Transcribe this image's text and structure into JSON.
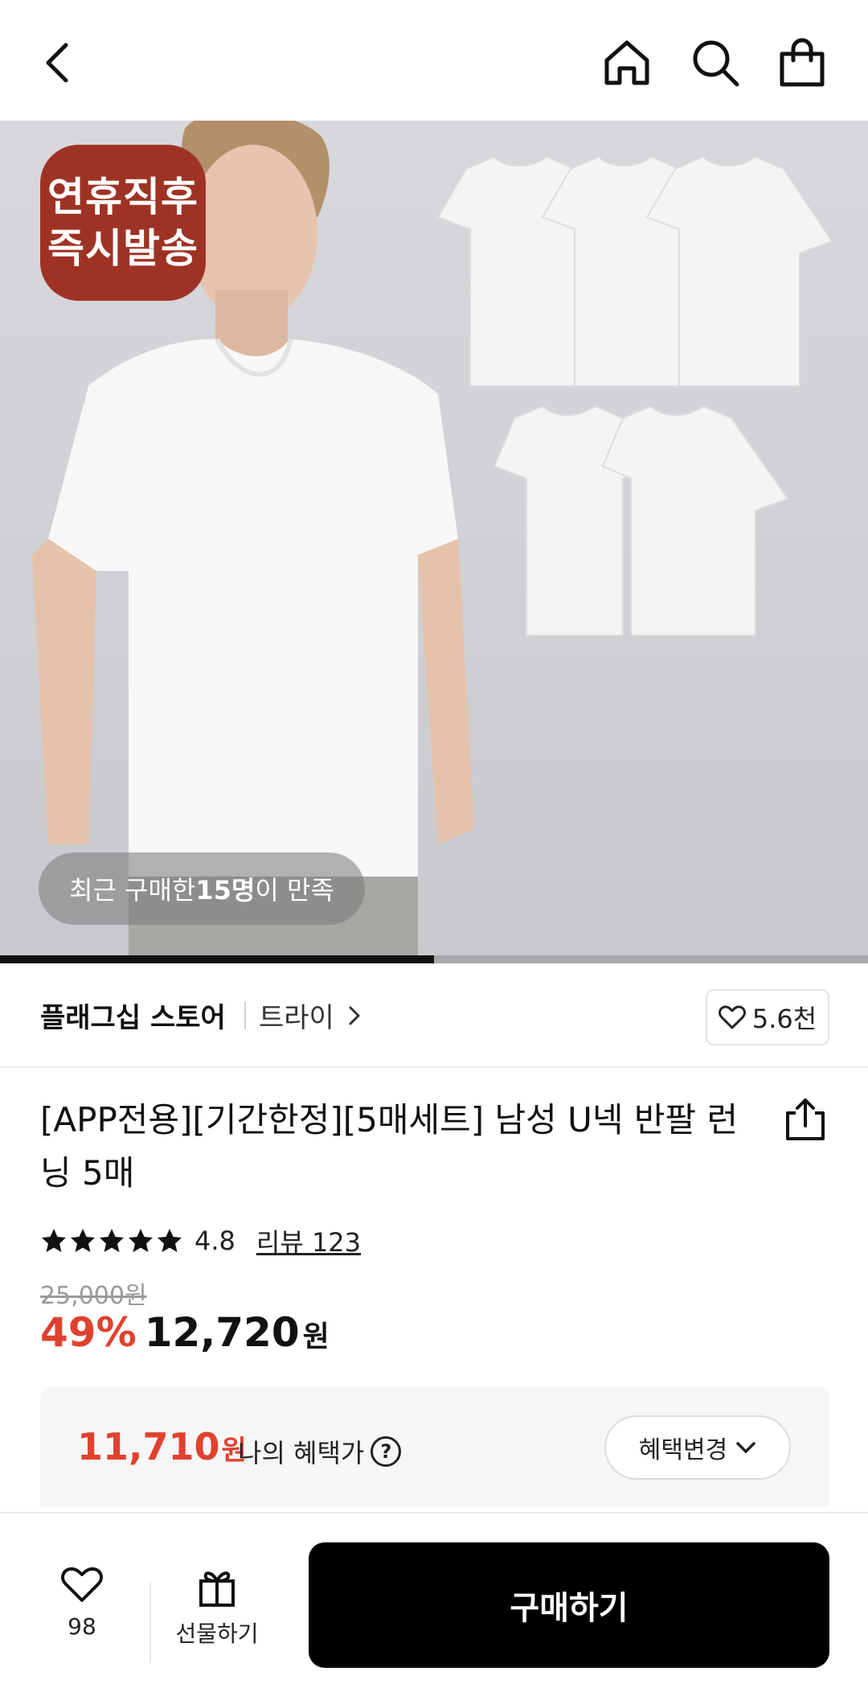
{
  "header": {
    "icons": [
      "back-icon",
      "home-icon",
      "search-icon",
      "shopping-bag-icon"
    ]
  },
  "hero": {
    "badge_line1": "연휴직후",
    "badge_line2": "즉시발송",
    "social_pre": "최근 구매한 ",
    "social_bold": "15명",
    "social_post": "이 만족",
    "progress_fraction": 0.5,
    "colors": {
      "badge": "#9e3325"
    }
  },
  "store": {
    "name": "플래그십 스토어",
    "sub": "트라이",
    "like_count": "5.6천"
  },
  "product": {
    "title": "[APP전용][기간한정][5매세트] 남성 U넥 반팔 런닝 5매",
    "rating": "4.8",
    "stars": 5,
    "review_link": "리뷰 123",
    "original_price": "25,000원",
    "discount": "49%",
    "price": "12,720",
    "price_unit": "원"
  },
  "benefit": {
    "price": "11,710",
    "unit": "원",
    "label": "나의 혜택가",
    "help": "?",
    "button": "혜택변경"
  },
  "bottom": {
    "wish_count": "98",
    "gift_label": "선물하기",
    "buy_label": "구매하기"
  },
  "colors": {
    "accent": "#e0412f",
    "primary": "#000000"
  }
}
